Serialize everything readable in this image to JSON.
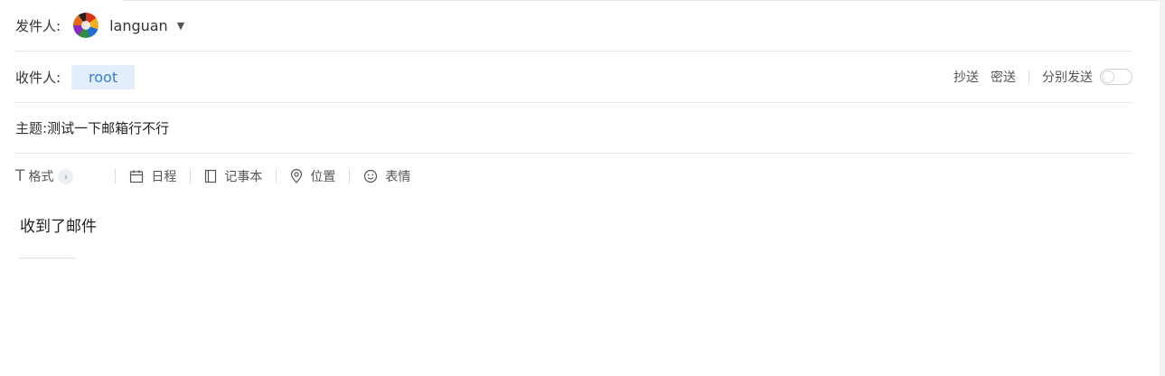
{
  "sender": {
    "label": "发件人:",
    "name": "languan"
  },
  "recipient": {
    "label": "收件人:",
    "chips": [
      "root"
    ],
    "cc_label": "抄送",
    "bcc_label": "密送",
    "separate_send_label": "分别发送",
    "separate_send_on": false
  },
  "subject": {
    "label": "主题:",
    "value": "测试一下邮箱行不行"
  },
  "toolbar": {
    "format_label": "格式",
    "schedule_label": "日程",
    "notebook_label": "记事本",
    "location_label": "位置",
    "emoji_label": "表情"
  },
  "body": {
    "text": "收到了邮件"
  },
  "colors": {
    "chip_bg": "#e3eefc",
    "chip_text": "#3b7dd8",
    "divider": "#e6e6e6"
  }
}
